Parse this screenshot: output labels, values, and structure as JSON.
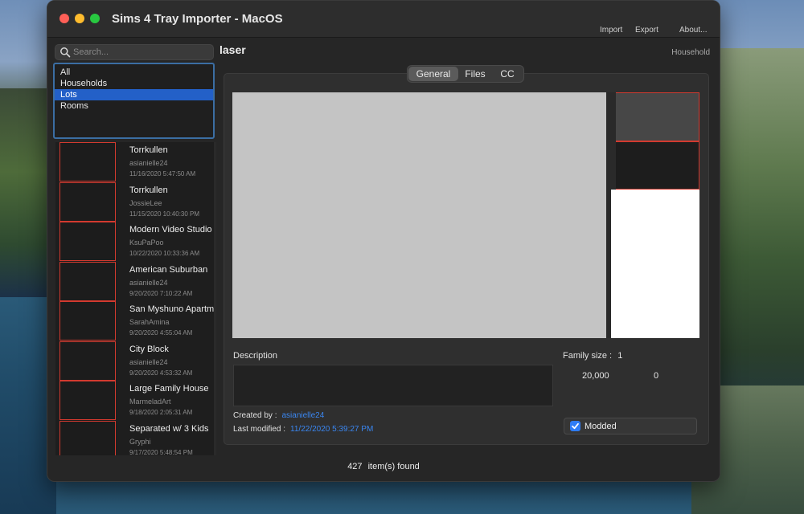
{
  "window": {
    "title": "Sims 4 Tray Importer - MacOS"
  },
  "menu": {
    "import": "Import",
    "export": "Export",
    "about": "About..."
  },
  "search": {
    "placeholder": "Search..."
  },
  "filters": [
    {
      "label": "All",
      "selected": false
    },
    {
      "label": "Households",
      "selected": false
    },
    {
      "label": "Lots",
      "selected": true
    },
    {
      "label": "Rooms",
      "selected": false
    }
  ],
  "results": [
    {
      "name": "Torrkullen",
      "author": "asianielle24",
      "date": "11/16/2020 5:47:50 AM"
    },
    {
      "name": "Torrkullen",
      "author": "JossieLee",
      "date": "11/15/2020 10:40:30 PM"
    },
    {
      "name": "Modern Video Studio",
      "author": "KsuPaPoo",
      "date": "10/22/2020 10:33:36 AM"
    },
    {
      "name": "American Suburban",
      "author": "asianielle24",
      "date": "9/20/2020 7:10:22 AM"
    },
    {
      "name": "San Myshuno Apartm",
      "author": "SarahAmina",
      "date": "9/20/2020 4:55:04 AM"
    },
    {
      "name": "City Block",
      "author": "asianielle24",
      "date": "9/20/2020 4:53:32 AM"
    },
    {
      "name": "Large Family House",
      "author": "MarmeladArt",
      "date": "9/18/2020 2:05:31 AM"
    },
    {
      "name": "Separated w/ 3 Kids",
      "author": "Gryphi",
      "date": "9/17/2020 5:48:54 PM"
    }
  ],
  "detail": {
    "name": "laser",
    "type": "Household",
    "tabs": [
      {
        "label": "General",
        "active": true
      },
      {
        "label": "Files",
        "active": false
      },
      {
        "label": "CC",
        "active": false
      }
    ],
    "description_label": "Description",
    "description": "",
    "created_by_label": "Created by :",
    "created_by": "asianielle24",
    "last_modified_label": "Last modified :",
    "last_modified": "11/22/2020 5:39:27 PM",
    "family_size_label": "Family size :",
    "family_size": "1",
    "funds": "20,000",
    "value": "0",
    "modded_label": "Modded",
    "modded": true
  },
  "status": {
    "count": "427",
    "suffix": "item(s) found"
  },
  "colors": {
    "accent": "#2360c8",
    "link": "#3a86f0",
    "thumb_border": "#d33a2f"
  }
}
